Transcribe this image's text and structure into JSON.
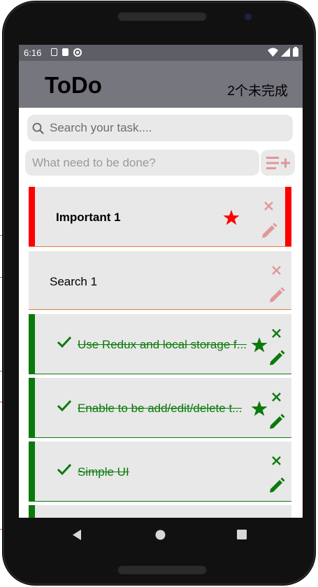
{
  "status_bar": {
    "time": "6:16"
  },
  "header": {
    "title": "ToDo",
    "remaining": "2个未完成"
  },
  "search": {
    "placeholder": "Search your task...."
  },
  "add": {
    "placeholder": "What need to be done?"
  },
  "todos": [
    {
      "text": "Important 1",
      "important": true,
      "completed": false,
      "accent": "#ff0000"
    },
    {
      "text": "Search 1",
      "important": false,
      "completed": false,
      "accent": "#e07a3a"
    },
    {
      "text": "Use Redux and local storage f...",
      "important": true,
      "completed": true,
      "accent": "#0b7a0b"
    },
    {
      "text": "Enable to be add/edit/delete t...",
      "important": true,
      "completed": true,
      "accent": "#0b7a0b"
    },
    {
      "text": "Simple UI",
      "important": false,
      "completed": true,
      "accent": "#0b7a0b"
    }
  ],
  "colors": {
    "header": "#76767f",
    "status_bar": "#5d5e66",
    "important": "#ff0000",
    "done": "#0b7a0b",
    "action_faded": "#e0979b"
  },
  "icons": [
    "search-icon",
    "add-list-icon",
    "star-icon",
    "close-icon",
    "pencil-icon",
    "check-icon",
    "back-icon",
    "home-icon",
    "recents-icon"
  ]
}
